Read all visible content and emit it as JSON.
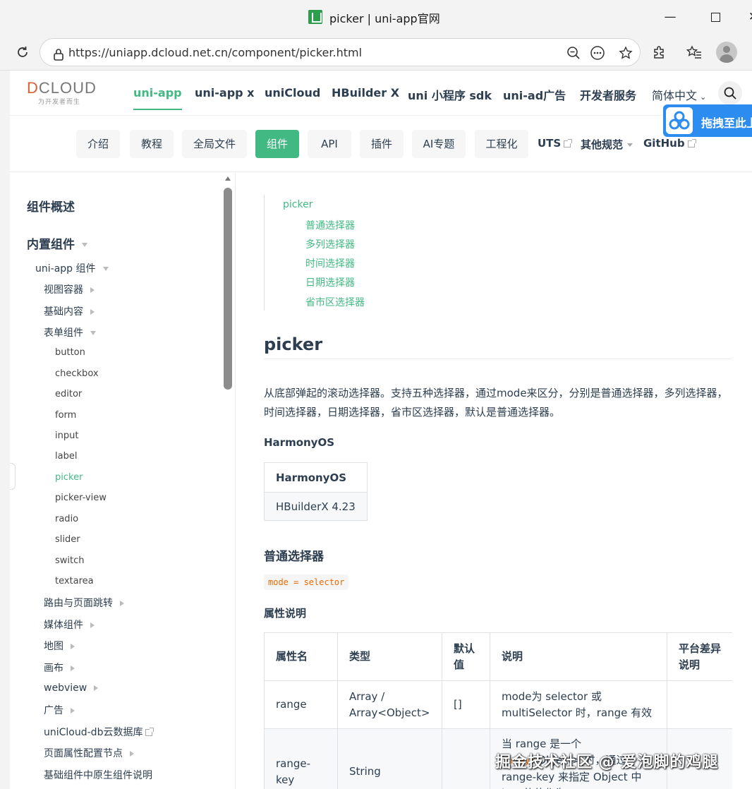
{
  "browser": {
    "tab_title": "picker | uni-app官网",
    "url": "https://uniapp.dcloud.net.cn/component/picker.html",
    "minimize": "—",
    "close": "✕"
  },
  "logo": {
    "wordmark_prefix": "D",
    "wordmark_rest": "CLOUD",
    "tagline": "为开发者而生"
  },
  "nav": {
    "items": [
      "uni-app",
      "uni-app x",
      "uniCloud",
      "HBuilder X",
      "uni 小程序 sdk",
      "uni-ad广告",
      "开发者服务"
    ],
    "active_index": 0,
    "language": "简体中文"
  },
  "baidu_float": {
    "label": "拖拽至此上"
  },
  "subnav": {
    "pills": [
      "介绍",
      "教程",
      "全局文件",
      "组件",
      "API",
      "插件",
      "AI专题",
      "工程化"
    ],
    "active_index": 3,
    "plain": [
      "UTS",
      "其他规范",
      "GitHub"
    ]
  },
  "sidebar": {
    "overview": "组件概述",
    "builtin": "内置组件",
    "uniapp_group": "uni-app 组件",
    "view_container": "视图容器",
    "basic_content": "基础内容",
    "form_group": "表单组件",
    "form_items": [
      "button",
      "checkbox",
      "editor",
      "form",
      "input",
      "label",
      "picker",
      "picker-view",
      "radio",
      "slider",
      "switch",
      "textarea"
    ],
    "active_form_item": "picker",
    "more_groups": [
      "路由与页面跳转",
      "媒体组件",
      "地图",
      "画布",
      "webview",
      "广告",
      "uniCloud-db云数据库",
      "页面属性配置节点",
      "基础组件中原生组件说明"
    ]
  },
  "toc": {
    "root": "picker",
    "children": [
      "普通选择器",
      "多列选择器",
      "时间选择器",
      "日期选择器",
      "省市区选择器"
    ]
  },
  "article": {
    "title": "picker",
    "intro": "从底部弹起的滚动选择器。支持五种选择器，通过mode来区分，分别是普通选择器，多列选择器，时间选择器，日期选择器，省市区选择器，默认是普通选择器。",
    "harmony_label": "HarmonyOS",
    "harmony_table": {
      "header": "HarmonyOS",
      "value": "HBuilderX 4.23"
    },
    "section_title": "普通选择器",
    "mode_code": "mode = selector",
    "props_label": "属性说明",
    "props_table": {
      "headers": [
        "属性名",
        "类型",
        "默认值",
        "说明",
        "平台差异说明"
      ],
      "rows": [
        {
          "name": "range",
          "type": "Array / Array<Object>",
          "default": "[]",
          "desc": "mode为 selector 或 multiSelector 时，range 有效",
          "platform": ""
        },
        {
          "name": "range-key",
          "type": "String",
          "default": "",
          "desc_prefix": "当 range 是一个",
          "desc_code": "Array<",
          "desc_rest": "Object> 时，通过 range-key 来指定 Object 中 key 的值作为",
          "platform": ""
        }
      ]
    }
  },
  "watermark": "掘金技术社区 @ 爱泡脚的鸡腿"
}
